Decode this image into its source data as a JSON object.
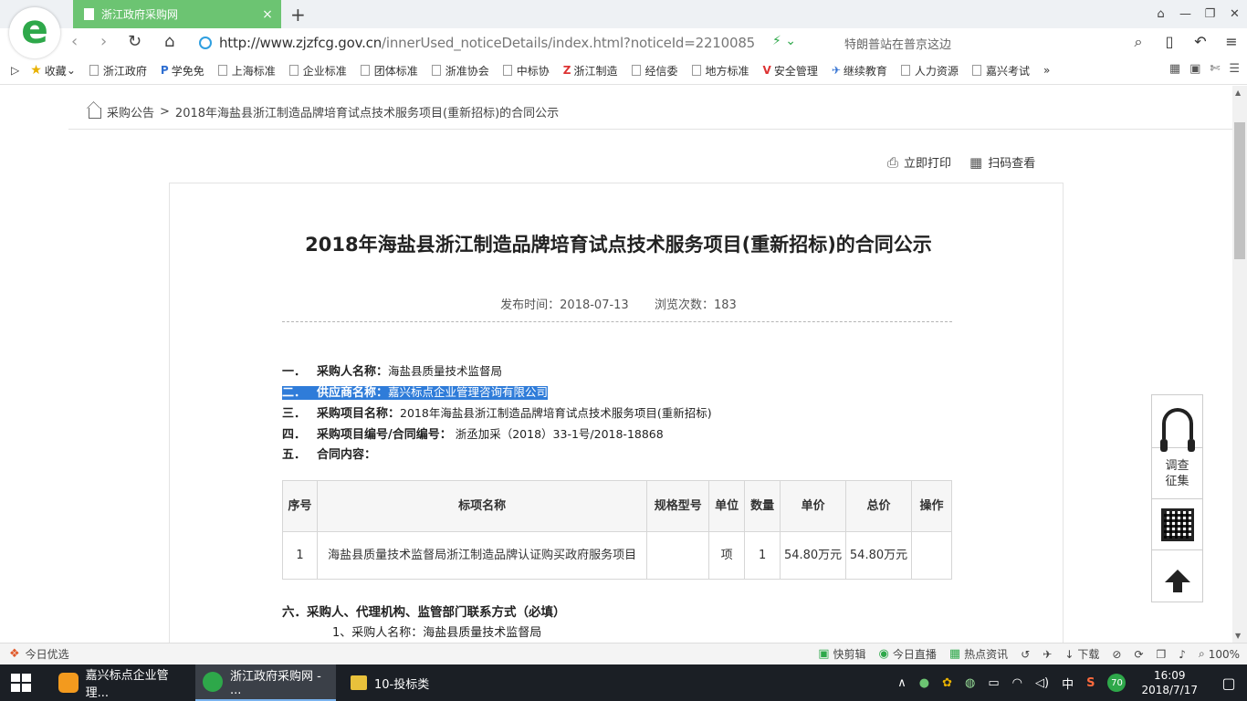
{
  "browser": {
    "tab_title": "浙江政府采购网",
    "tab_close": "×",
    "new_tab": "+",
    "url_domain": "http://www.zjzfcg.gov.cn",
    "url_path": "/innerUsed_noticeDetails/index.html?noticeId=2210085",
    "search_hint": "特朗普站在普京这边",
    "bookmarks": [
      "收藏",
      "浙江政府",
      "学免免",
      "上海标准",
      "企业标准",
      "团体标准",
      "浙准协会",
      "中标协",
      "浙江制造",
      "经信委",
      "地方标准",
      "安全管理",
      "继续教育",
      "人力资源",
      "嘉兴考试"
    ],
    "bookmarks_more": "»"
  },
  "breadcrumb": {
    "home": "采购公告",
    "sep": ">",
    "current": "2018年海盐县浙江制造品牌培育试点技术服务项目(重新招标)的合同公示"
  },
  "actions": {
    "print": "立即打印",
    "scan": "扫码查看"
  },
  "notice": {
    "title": "2018年海盐县浙江制造品牌培育试点技术服务项目(重新招标)的合同公示",
    "publish_label": "发布时间：",
    "publish_date": "2018-07-13",
    "views_label": "浏览次数：",
    "views": "183",
    "items": [
      {
        "num": "一．",
        "label": "采购人名称：",
        "value": "海盐县质量技术监督局"
      },
      {
        "num": "二．",
        "label": "供应商名称：",
        "value": "嘉兴标点企业管理咨询有限公司"
      },
      {
        "num": "三．",
        "label": "采购项目名称：",
        "value": "2018年海盐县浙江制造品牌培育试点技术服务项目(重新招标)"
      },
      {
        "num": "四．",
        "label": "采购项目编号/合同编号：",
        "value": " 浙丞加采（2018）33-1号/2018-18868"
      },
      {
        "num": "五．",
        "label": "合同内容：",
        "value": ""
      }
    ],
    "table": {
      "headers": [
        "序号",
        "标项名称",
        "规格型号",
        "单位",
        "数量",
        "单价",
        "总价",
        "操作"
      ],
      "rows": [
        [
          "1",
          "海盐县质量技术监督局浙江制造品牌认证购买政府服务项目",
          "",
          "项",
          "1",
          "54.80万元",
          "54.80万元",
          ""
        ]
      ]
    },
    "section6_title": "六．采购人、代理机构、监管部门联系方式（必填）",
    "section6_item1": "1、采购人名称：海盐县质量技术监督局"
  },
  "sidepanel": {
    "survey": "调查征集"
  },
  "statusbar": {
    "left": "今日优选",
    "items": [
      "快剪辑",
      "今日直播",
      "热点资讯",
      "下载"
    ],
    "zoom": "100%"
  },
  "taskbar": {
    "tasks": [
      "嘉兴标点企业管理...",
      "浙江政府采购网 - ...",
      "10-投标类"
    ],
    "ime": "中",
    "badge": "70",
    "time": "16:09",
    "date": "2018/7/17"
  }
}
